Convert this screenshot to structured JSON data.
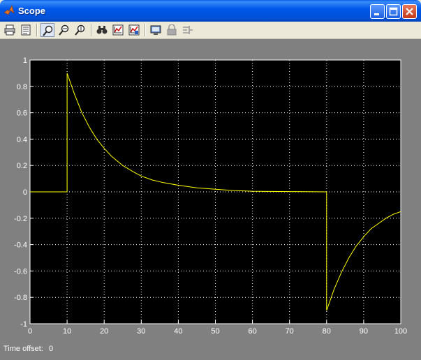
{
  "window": {
    "title": "Scope",
    "icon": "matlab-icon"
  },
  "title_buttons": [
    "minimize-icon",
    "maximize-icon",
    "close-icon"
  ],
  "toolbar": {
    "items": [
      "print-icon",
      "parameters-icon",
      "zoom-icon",
      "zoom-x-icon",
      "zoom-y-icon",
      "autoscale-icon",
      "save-axes-settings-icon",
      "restore-axes-settings-icon",
      "floating-scope-icon",
      "lock-axes-icon",
      "signal-selection-icon"
    ],
    "active": "zoom-icon"
  },
  "status": {
    "time_offset_label": "Time offset:",
    "time_offset_value": "0"
  },
  "colors": {
    "plot_background": "#000000",
    "figure_background": "#808080",
    "signal": "#ffff00",
    "grid": "#ffffff",
    "tick_text": "#ffffff"
  },
  "chart_data": {
    "type": "line",
    "title": "",
    "xlabel": "",
    "ylabel": "",
    "xlim": [
      0,
      100
    ],
    "ylim": [
      -1,
      1
    ],
    "xticks": [
      "0",
      "10",
      "20",
      "30",
      "40",
      "50",
      "60",
      "70",
      "80",
      "90",
      "100"
    ],
    "yticks": [
      "1",
      "0.8",
      "0.6",
      "0.4",
      "0.2",
      "0",
      "-0.2",
      "-0.4",
      "-0.6",
      "-0.8",
      "-1"
    ],
    "grid": true,
    "series": [
      {
        "color": "#ffff00",
        "x": [
          0,
          10,
          10,
          12,
          14,
          16,
          18,
          20,
          22,
          25,
          28,
          30,
          33,
          36,
          40,
          45,
          50,
          55,
          60,
          65,
          70,
          75,
          80,
          80,
          82,
          84,
          86,
          88,
          90,
          92,
          94,
          96,
          98,
          100
        ],
        "y": [
          0,
          0,
          0.9,
          0.74,
          0.6,
          0.49,
          0.4,
          0.33,
          0.27,
          0.2,
          0.15,
          0.12,
          0.09,
          0.07,
          0.05,
          0.03,
          0.02,
          0.01,
          0.005,
          0.003,
          0.002,
          0.001,
          0,
          -0.9,
          -0.74,
          -0.61,
          -0.5,
          -0.41,
          -0.34,
          -0.28,
          -0.24,
          -0.2,
          -0.17,
          -0.15
        ]
      }
    ]
  }
}
